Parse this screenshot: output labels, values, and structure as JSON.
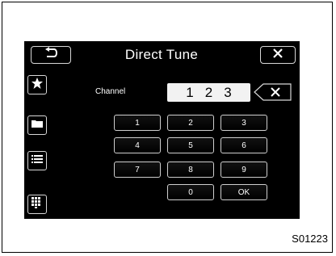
{
  "header": {
    "title": "Direct Tune",
    "back_icon": "back-arrow-icon",
    "close_icon": "close-icon"
  },
  "sidebar": {
    "items": [
      {
        "icon": "star-icon"
      },
      {
        "icon": "folder-icon"
      },
      {
        "icon": "list-icon"
      },
      {
        "icon": "keypad-icon"
      }
    ]
  },
  "channel": {
    "label": "Channel",
    "digits": [
      "1",
      "2",
      "3"
    ]
  },
  "keypad": {
    "keys": [
      "1",
      "2",
      "3",
      "4",
      "5",
      "6",
      "7",
      "8",
      "9",
      "0",
      "OK"
    ]
  },
  "figure_code": "S01223"
}
